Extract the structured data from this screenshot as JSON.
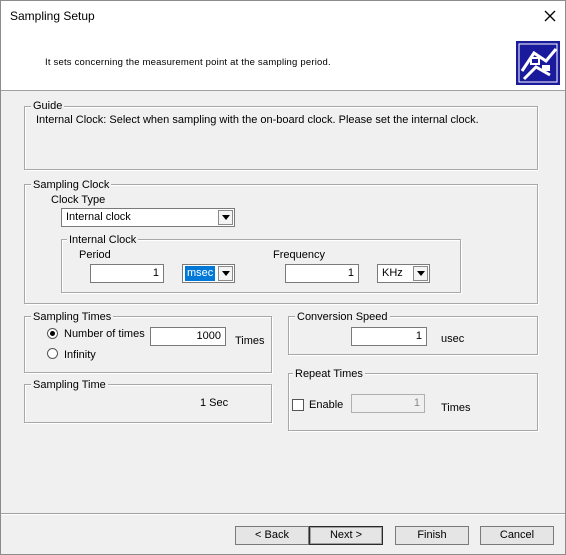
{
  "window": {
    "title": "Sampling Setup"
  },
  "header": {
    "description": "It sets concerning the measurement point at the sampling period."
  },
  "guide": {
    "label": "Guide",
    "text": "Internal Clock: Select when sampling with the on-board clock. Please set the internal clock."
  },
  "sampling_clock": {
    "label": "Sampling Clock",
    "clock_type_label": "Clock Type",
    "clock_type_value": "Internal clock",
    "internal_clock": {
      "label": "Internal Clock",
      "period_label": "Period",
      "period_value": "1",
      "period_unit": "msec",
      "frequency_label": "Frequency",
      "frequency_value": "1",
      "frequency_unit": "KHz"
    }
  },
  "sampling_times": {
    "label": "Sampling Times",
    "option_number_label": "Number of times",
    "option_number_selected": true,
    "option_infinity_label": "Infinity",
    "times_value": "1000",
    "times_unit": "Times"
  },
  "sampling_time": {
    "label": "Sampling Time",
    "value": "1 Sec"
  },
  "conversion_speed": {
    "label": "Conversion Speed",
    "value": "1",
    "unit": "usec"
  },
  "repeat_times": {
    "label": "Repeat Times",
    "enable_label": "Enable",
    "enable_checked": false,
    "value": "1",
    "unit": "Times"
  },
  "buttons": {
    "back": "< Back",
    "next": "Next >",
    "finish": "Finish",
    "cancel": "Cancel"
  },
  "colors": {
    "selection": "#0078d7",
    "dialog_bg": "#f0f0f0",
    "header_bg": "#ffffff",
    "logo": "#1a1a9c"
  }
}
